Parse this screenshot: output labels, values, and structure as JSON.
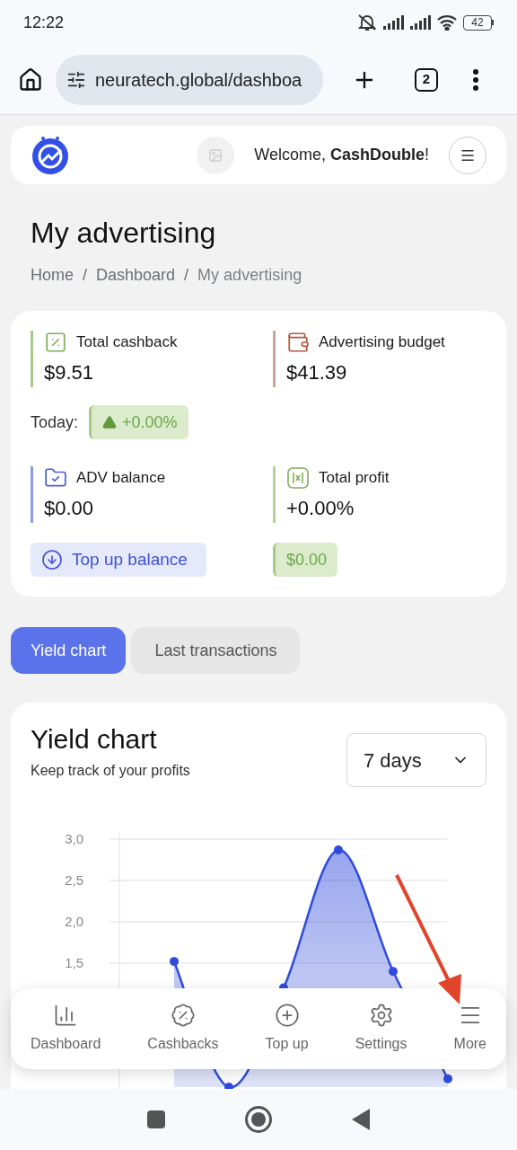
{
  "status_bar": {
    "time": "12:22",
    "battery": "42"
  },
  "browser": {
    "url": "neuratech.global/dashboa",
    "tab_count": "2"
  },
  "header": {
    "welcome": "Welcome, **CashDouble**!"
  },
  "page": {
    "title": "My advertising",
    "separator": "/",
    "breadcrumbs": [
      "Home",
      "Dashboard",
      "My advertising"
    ]
  },
  "stats": {
    "items": [
      {
        "label": "Total cashback",
        "value": "$9.51",
        "color": "#a9c98a"
      },
      {
        "label": "Advertising budget",
        "value": "$41.39",
        "color": "#c9a497"
      },
      {
        "label": "ADV balance",
        "value": "$0.00",
        "color": "#8f9be8"
      },
      {
        "label": "Total profit",
        "value": "+0.00%",
        "color": "#b9d39e"
      }
    ],
    "today_label": "Today:",
    "today_change": "+0.00%",
    "top_up_button": "Top up balance",
    "profit_amount": "$0.00"
  },
  "tabs": [
    {
      "label": "Yield chart",
      "selected": true
    },
    {
      "label": "Last transactions",
      "selected": false
    }
  ],
  "chart_card": {
    "title": "Yield chart",
    "subtitle": "Keep track of your profits",
    "period": "7 days",
    "chart_data": {
      "type": "area",
      "grid": true,
      "series": [
        {
          "color": "#2f4bdc",
          "values": [
            null,
            1.52,
            0.0,
            1.2,
            2.87,
            1.4,
            0.1
          ]
        }
      ],
      "ylim": [
        0,
        3
      ],
      "yticks": [
        {
          "value": 1.5,
          "label": "1,5"
        },
        {
          "value": 2.0,
          "label": "2,0"
        },
        {
          "value": 2.5,
          "label": "2,5"
        },
        {
          "value": 3.0,
          "label": "3,0"
        }
      ]
    }
  },
  "bottom_nav": [
    {
      "label": "Dashboard"
    },
    {
      "label": "Cashbacks"
    },
    {
      "label": "Top up"
    },
    {
      "label": "Settings"
    },
    {
      "label": "More"
    }
  ]
}
